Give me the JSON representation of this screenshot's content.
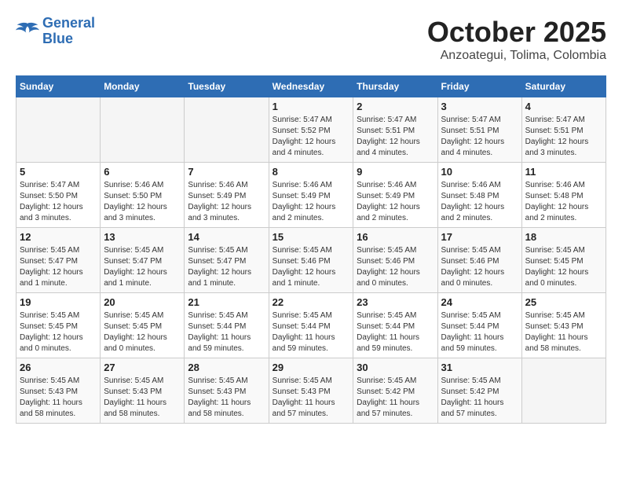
{
  "logo": {
    "line1": "General",
    "line2": "Blue"
  },
  "title": "October 2025",
  "subtitle": "Anzoategui, Tolima, Colombia",
  "headers": [
    "Sunday",
    "Monday",
    "Tuesday",
    "Wednesday",
    "Thursday",
    "Friday",
    "Saturday"
  ],
  "weeks": [
    [
      {
        "day": "",
        "info": ""
      },
      {
        "day": "",
        "info": ""
      },
      {
        "day": "",
        "info": ""
      },
      {
        "day": "1",
        "info": "Sunrise: 5:47 AM\nSunset: 5:52 PM\nDaylight: 12 hours\nand 4 minutes."
      },
      {
        "day": "2",
        "info": "Sunrise: 5:47 AM\nSunset: 5:51 PM\nDaylight: 12 hours\nand 4 minutes."
      },
      {
        "day": "3",
        "info": "Sunrise: 5:47 AM\nSunset: 5:51 PM\nDaylight: 12 hours\nand 4 minutes."
      },
      {
        "day": "4",
        "info": "Sunrise: 5:47 AM\nSunset: 5:51 PM\nDaylight: 12 hours\nand 3 minutes."
      }
    ],
    [
      {
        "day": "5",
        "info": "Sunrise: 5:47 AM\nSunset: 5:50 PM\nDaylight: 12 hours\nand 3 minutes."
      },
      {
        "day": "6",
        "info": "Sunrise: 5:46 AM\nSunset: 5:50 PM\nDaylight: 12 hours\nand 3 minutes."
      },
      {
        "day": "7",
        "info": "Sunrise: 5:46 AM\nSunset: 5:49 PM\nDaylight: 12 hours\nand 3 minutes."
      },
      {
        "day": "8",
        "info": "Sunrise: 5:46 AM\nSunset: 5:49 PM\nDaylight: 12 hours\nand 2 minutes."
      },
      {
        "day": "9",
        "info": "Sunrise: 5:46 AM\nSunset: 5:49 PM\nDaylight: 12 hours\nand 2 minutes."
      },
      {
        "day": "10",
        "info": "Sunrise: 5:46 AM\nSunset: 5:48 PM\nDaylight: 12 hours\nand 2 minutes."
      },
      {
        "day": "11",
        "info": "Sunrise: 5:46 AM\nSunset: 5:48 PM\nDaylight: 12 hours\nand 2 minutes."
      }
    ],
    [
      {
        "day": "12",
        "info": "Sunrise: 5:45 AM\nSunset: 5:47 PM\nDaylight: 12 hours\nand 1 minute."
      },
      {
        "day": "13",
        "info": "Sunrise: 5:45 AM\nSunset: 5:47 PM\nDaylight: 12 hours\nand 1 minute."
      },
      {
        "day": "14",
        "info": "Sunrise: 5:45 AM\nSunset: 5:47 PM\nDaylight: 12 hours\nand 1 minute."
      },
      {
        "day": "15",
        "info": "Sunrise: 5:45 AM\nSunset: 5:46 PM\nDaylight: 12 hours\nand 1 minute."
      },
      {
        "day": "16",
        "info": "Sunrise: 5:45 AM\nSunset: 5:46 PM\nDaylight: 12 hours\nand 0 minutes."
      },
      {
        "day": "17",
        "info": "Sunrise: 5:45 AM\nSunset: 5:46 PM\nDaylight: 12 hours\nand 0 minutes."
      },
      {
        "day": "18",
        "info": "Sunrise: 5:45 AM\nSunset: 5:45 PM\nDaylight: 12 hours\nand 0 minutes."
      }
    ],
    [
      {
        "day": "19",
        "info": "Sunrise: 5:45 AM\nSunset: 5:45 PM\nDaylight: 12 hours\nand 0 minutes."
      },
      {
        "day": "20",
        "info": "Sunrise: 5:45 AM\nSunset: 5:45 PM\nDaylight: 12 hours\nand 0 minutes."
      },
      {
        "day": "21",
        "info": "Sunrise: 5:45 AM\nSunset: 5:44 PM\nDaylight: 11 hours\nand 59 minutes."
      },
      {
        "day": "22",
        "info": "Sunrise: 5:45 AM\nSunset: 5:44 PM\nDaylight: 11 hours\nand 59 minutes."
      },
      {
        "day": "23",
        "info": "Sunrise: 5:45 AM\nSunset: 5:44 PM\nDaylight: 11 hours\nand 59 minutes."
      },
      {
        "day": "24",
        "info": "Sunrise: 5:45 AM\nSunset: 5:44 PM\nDaylight: 11 hours\nand 59 minutes."
      },
      {
        "day": "25",
        "info": "Sunrise: 5:45 AM\nSunset: 5:43 PM\nDaylight: 11 hours\nand 58 minutes."
      }
    ],
    [
      {
        "day": "26",
        "info": "Sunrise: 5:45 AM\nSunset: 5:43 PM\nDaylight: 11 hours\nand 58 minutes."
      },
      {
        "day": "27",
        "info": "Sunrise: 5:45 AM\nSunset: 5:43 PM\nDaylight: 11 hours\nand 58 minutes."
      },
      {
        "day": "28",
        "info": "Sunrise: 5:45 AM\nSunset: 5:43 PM\nDaylight: 11 hours\nand 58 minutes."
      },
      {
        "day": "29",
        "info": "Sunrise: 5:45 AM\nSunset: 5:43 PM\nDaylight: 11 hours\nand 57 minutes."
      },
      {
        "day": "30",
        "info": "Sunrise: 5:45 AM\nSunset: 5:42 PM\nDaylight: 11 hours\nand 57 minutes."
      },
      {
        "day": "31",
        "info": "Sunrise: 5:45 AM\nSunset: 5:42 PM\nDaylight: 11 hours\nand 57 minutes."
      },
      {
        "day": "",
        "info": ""
      }
    ]
  ]
}
